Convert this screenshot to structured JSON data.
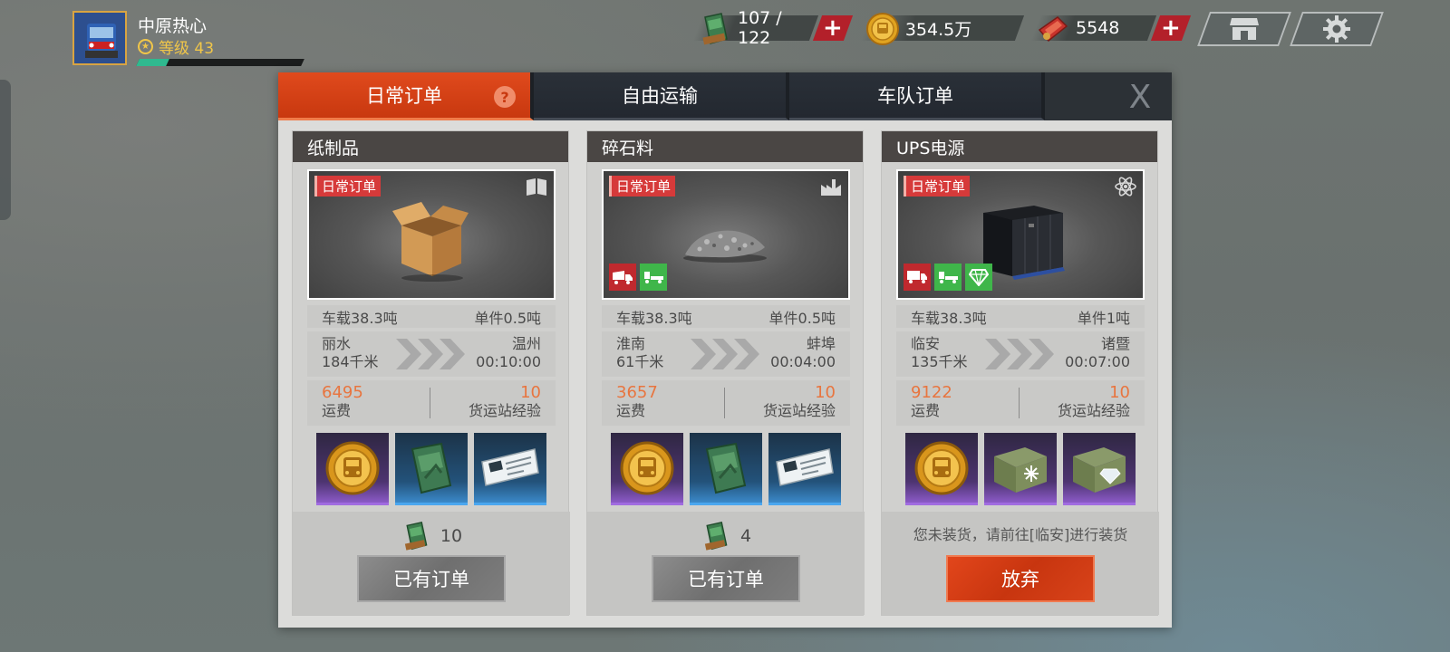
{
  "player": {
    "name": "中原热心",
    "level_label": "等级 43",
    "xp_fraction": 0.18
  },
  "resources": {
    "fuel": {
      "value": "107 / 122",
      "icon": "fuel-can-icon"
    },
    "coins": {
      "value": "354.5万",
      "icon": "gold-coin-icon"
    },
    "tickets": {
      "value": "5548",
      "icon": "red-ticket-icon"
    },
    "plus": "+"
  },
  "tabs": [
    {
      "label": "日常订单",
      "active": true
    },
    {
      "label": "自由运输",
      "active": false
    },
    {
      "label": "车队订单",
      "active": false
    }
  ],
  "help_label": "?",
  "close_label": "X",
  "colors": {
    "accent": "#c8380f",
    "tag_red": "#d63a3a",
    "green": "#3fb64a",
    "value_orange": "#e8753f"
  },
  "cards": [
    {
      "title": "纸制品",
      "tag": "日常订单",
      "type_icon": "book-icon",
      "load": "车载38.3吨",
      "unit": "单件0.5吨",
      "from": "丽水",
      "distance": "184千米",
      "to": "温州",
      "time": "00:10:00",
      "pay": "6495",
      "pay_label": "运费",
      "exp": "10",
      "exp_label": "货运站经验",
      "features": [],
      "rewards": [
        "gold-coin-icon",
        "fuel-can-icon",
        "ticket-card-icon"
      ],
      "fuel_cost": "10",
      "button": "已有订单",
      "hint": ""
    },
    {
      "title": "碎石料",
      "tag": "日常订单",
      "type_icon": "factory-icon",
      "load": "车载38.3吨",
      "unit": "单件0.5吨",
      "from": "淮南",
      "distance": "61千米",
      "to": "蚌埠",
      "time": "00:04:00",
      "pay": "3657",
      "pay_label": "运费",
      "exp": "10",
      "exp_label": "货运站经验",
      "features": [
        "dump-truck-icon",
        "semi-truck-icon"
      ],
      "rewards": [
        "gold-coin-icon",
        "fuel-can-icon",
        "ticket-card-icon"
      ],
      "fuel_cost": "4",
      "button": "已有订单",
      "hint": ""
    },
    {
      "title": "UPS电源",
      "tag": "日常订单",
      "type_icon": "atom-icon",
      "load": "车载38.3吨",
      "unit": "单件1吨",
      "from": "临安",
      "distance": "135千米",
      "to": "诸暨",
      "time": "00:07:00",
      "pay": "9122",
      "pay_label": "运费",
      "exp": "10",
      "exp_label": "货运站经验",
      "features": [
        "box-truck-icon",
        "semi-truck-icon",
        "diamond-icon"
      ],
      "rewards": [
        "gold-coin-icon",
        "snow-crate-icon",
        "diamond-crate-icon"
      ],
      "fuel_cost": "",
      "button": "放弃",
      "hint": "您未装货，请前往[临安]进行装货"
    }
  ]
}
